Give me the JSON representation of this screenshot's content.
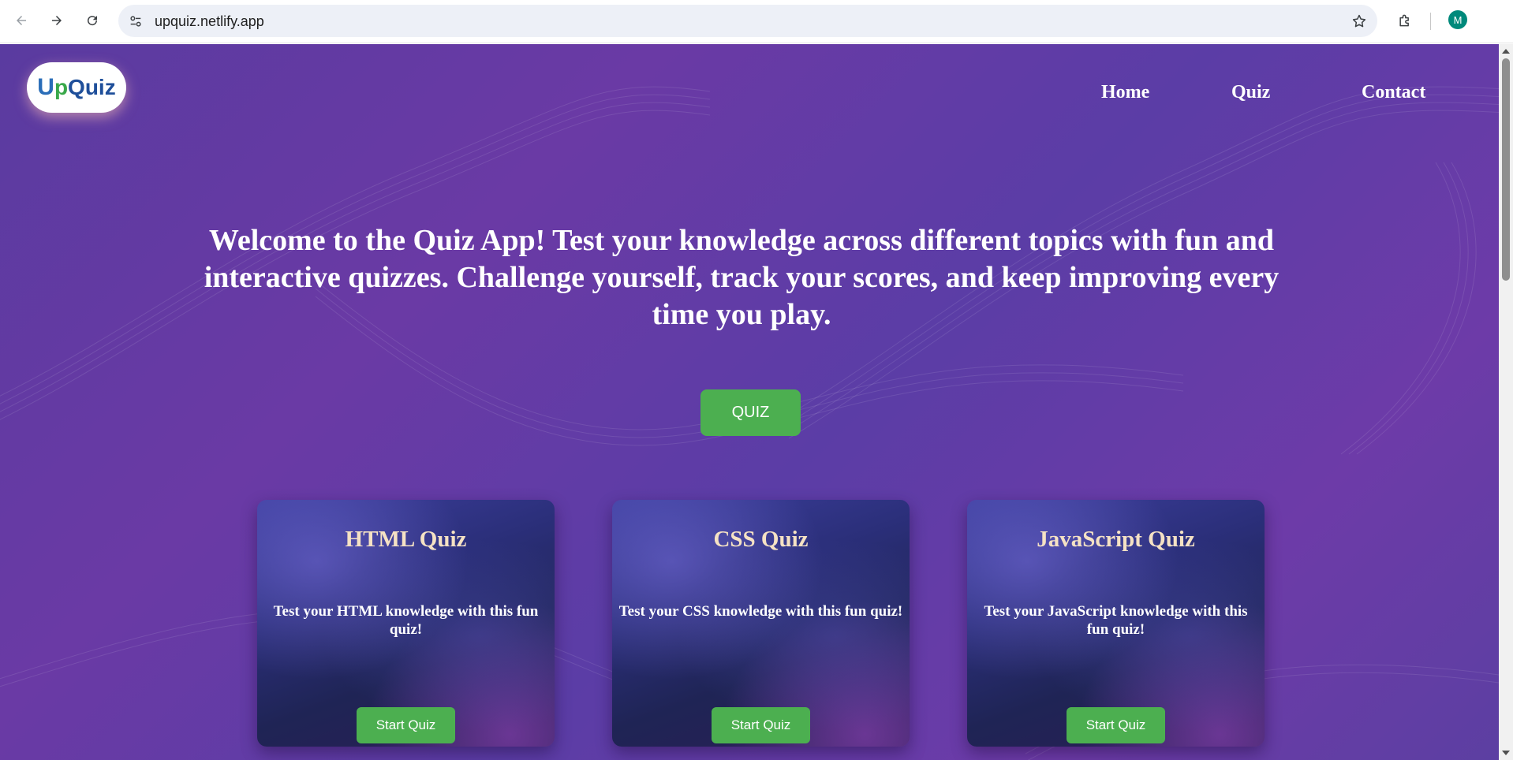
{
  "browser": {
    "url": "upquiz.netlify.app",
    "profile_initial": "M",
    "icons": {
      "back": "back-arrow-icon",
      "forward": "forward-arrow-icon",
      "reload": "reload-icon",
      "site_info": "tune-icon",
      "bookmark": "star-icon",
      "extensions": "puzzle-icon"
    }
  },
  "site": {
    "logo": {
      "letter_u": "U",
      "up": "p",
      "quiz": "Quiz"
    },
    "nav": [
      {
        "label": "Home"
      },
      {
        "label": "Quiz"
      },
      {
        "label": "Contact"
      }
    ],
    "hero_text": "Welcome to the Quiz App! Test your knowledge across different topics with fun and interactive quizzes. Challenge yourself, track your scores, and keep improving every time you play.",
    "hero_button": "QUIZ",
    "cards": [
      {
        "title": "HTML Quiz",
        "description": "Test your HTML knowledge with this fun quiz!",
        "button": "Start Quiz"
      },
      {
        "title": "CSS Quiz",
        "description": "Test your CSS knowledge with this fun quiz!",
        "button": "Start Quiz"
      },
      {
        "title": "JavaScript Quiz",
        "description": "Test your JavaScript knowledge with this fun quiz!",
        "button": "Start Quiz"
      }
    ]
  },
  "colors": {
    "background_purple": "#5e3ca3",
    "button_green": "#4caf50",
    "card_title": "#f5e2c4",
    "logo_blue": "#1f4f9a",
    "logo_green": "#39a84a"
  }
}
